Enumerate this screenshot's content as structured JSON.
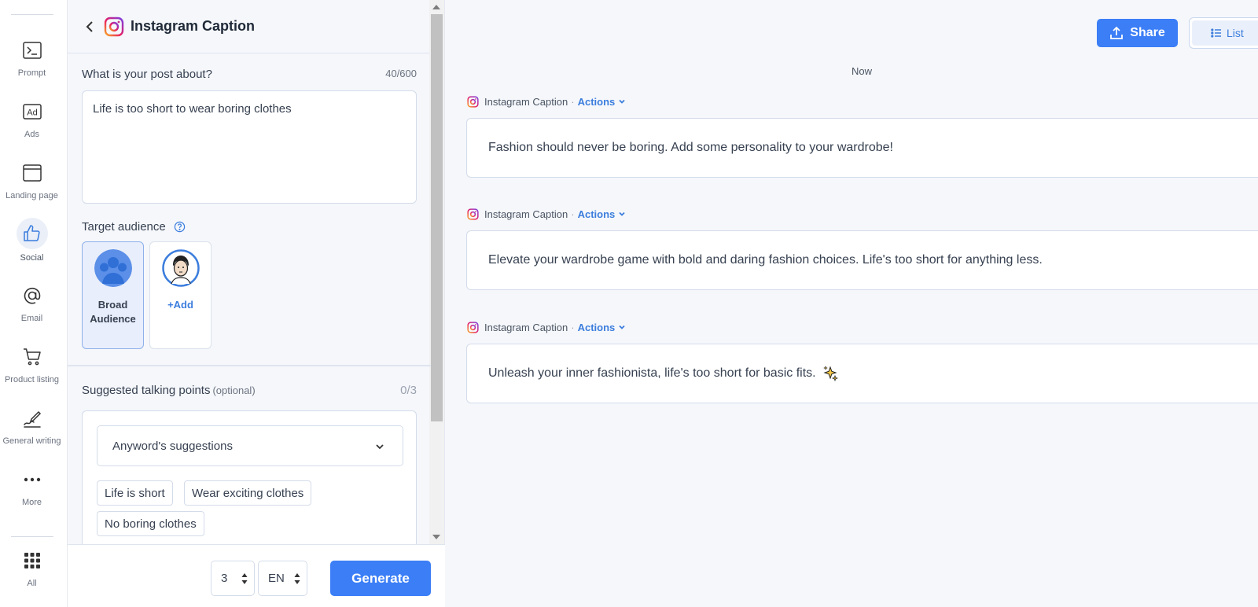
{
  "nav": {
    "items": [
      {
        "label": "Prompt",
        "icon": "terminal-icon"
      },
      {
        "label": "Ads",
        "icon": "ad-icon"
      },
      {
        "label": "Landing page",
        "icon": "browser-window-icon"
      },
      {
        "label": "Social",
        "icon": "thumbs-up-icon"
      },
      {
        "label": "Email",
        "icon": "at-sign-icon"
      },
      {
        "label": "Product listing",
        "icon": "shopping-cart-icon"
      },
      {
        "label": "General writing",
        "icon": "pen-writing-icon"
      },
      {
        "label": "More",
        "icon": "more-dots-icon"
      },
      {
        "label": "All",
        "icon": "grid-icon"
      }
    ],
    "active": "Social",
    "ad_glyph": "Ad"
  },
  "form": {
    "title": "Instagram Caption",
    "post_about": {
      "label": "What is your post about?",
      "count": "40/600",
      "value": "Life is too short to wear boring clothes"
    },
    "audience": {
      "label": "Target audience",
      "cards": [
        {
          "name_line1": "Broad",
          "name_line2": "Audience",
          "selected": true
        },
        {
          "add_label": "+Add"
        }
      ]
    },
    "talking_points": {
      "label": "Suggested talking points",
      "optional": "(optional)",
      "count": "0/3",
      "dropdown": "Anyword's suggestions",
      "chips": [
        "Life is short",
        "Wear exciting clothes",
        "No boring clothes"
      ]
    },
    "footer": {
      "variations": "3",
      "language": "EN",
      "generate": "Generate"
    }
  },
  "output": {
    "share": "Share",
    "list": "List",
    "timestamp": "Now",
    "results": [
      {
        "source": "Instagram Caption",
        "sep": "·",
        "actions": "Actions",
        "text": "Fashion should never be boring. Add some personality to your wardrobe!"
      },
      {
        "source": "Instagram Caption",
        "sep": "·",
        "actions": "Actions",
        "text": "Elevate your wardrobe game with bold and daring fashion choices. Life's too short for anything less."
      },
      {
        "source": "Instagram Caption",
        "sep": "·",
        "actions": "Actions",
        "text": "Unleash your inner fashionista, life's too short for basic fits."
      }
    ]
  },
  "colors": {
    "accent": "#3b7ef6",
    "link": "#3b7ddd",
    "background": "#f5f7fb",
    "border": "#d4dcea"
  }
}
